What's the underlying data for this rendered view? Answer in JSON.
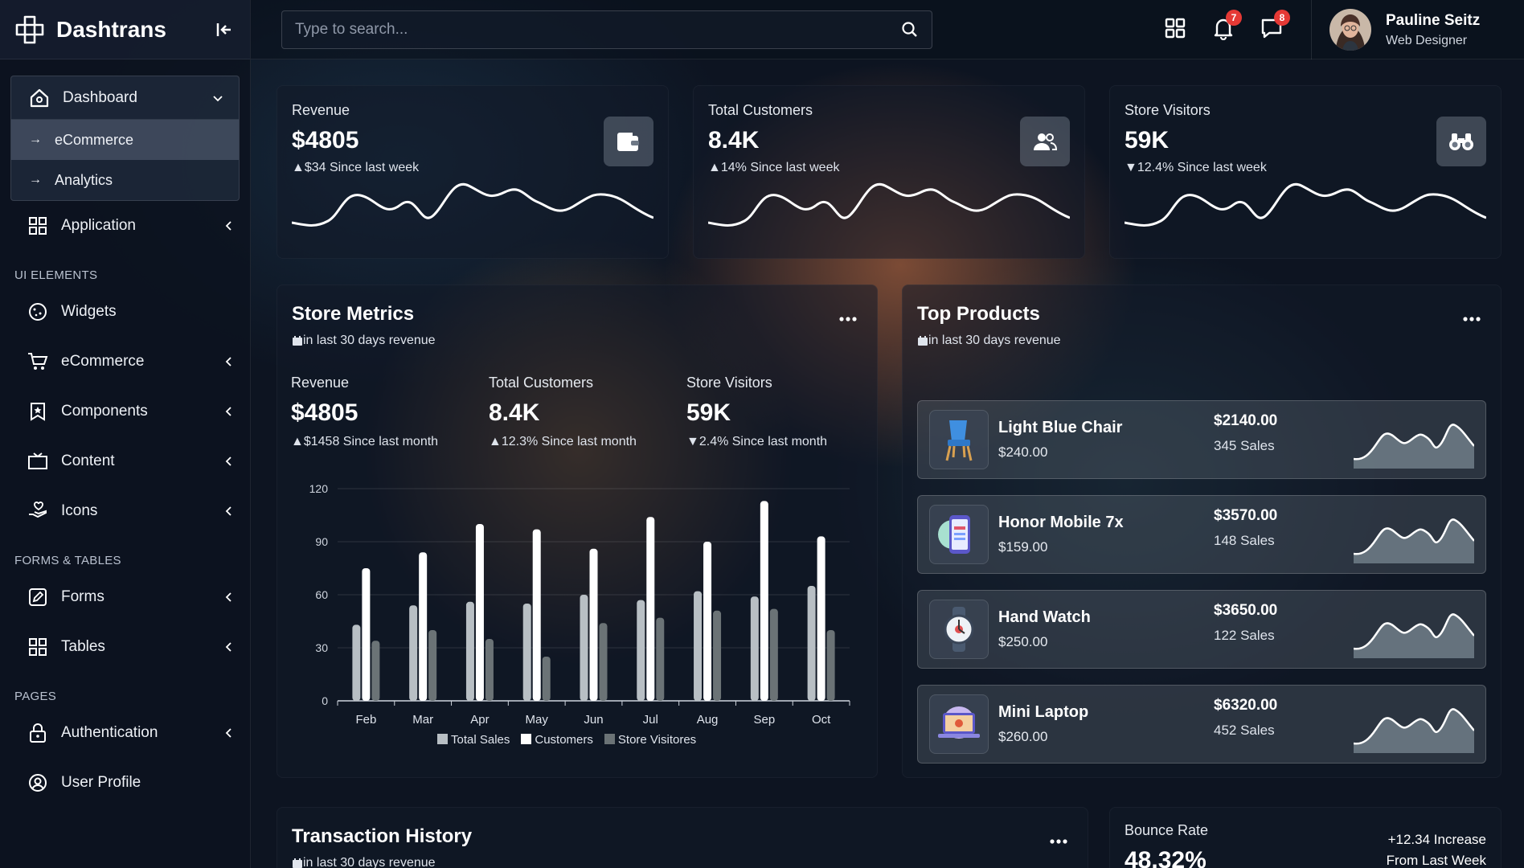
{
  "brand": {
    "name": "Dashtrans"
  },
  "search": {
    "placeholder": "Type to search..."
  },
  "topbar": {
    "notifications_count": "7",
    "messages_count": "8",
    "user_name": "Pauline Seitz",
    "user_role": "Web Designer"
  },
  "sidebar": {
    "dashboard": "Dashboard",
    "dashboard_sub": [
      "eCommerce",
      "Analytics"
    ],
    "application": "Application",
    "section_ui": "UI ELEMENTS",
    "widgets": "Widgets",
    "ecommerce": "eCommerce",
    "components": "Components",
    "content": "Content",
    "icons": "Icons",
    "section_forms": "FORMS & TABLES",
    "forms": "Forms",
    "tables": "Tables",
    "section_pages": "PAGES",
    "authentication": "Authentication",
    "user_profile": "User Profile"
  },
  "stats": [
    {
      "label": "Revenue",
      "value": "$4805",
      "trend": "$34 Since last week",
      "direction": "up",
      "icon": "wallet-icon"
    },
    {
      "label": "Total Customers",
      "value": "8.4K",
      "trend": "14% Since last week",
      "direction": "up",
      "icon": "users-icon"
    },
    {
      "label": "Store Visitors",
      "value": "59K",
      "trend": "12.4% Since last week",
      "direction": "down",
      "icon": "binoculars-icon"
    }
  ],
  "store_metrics": {
    "title": "Store Metrics",
    "subtitle": "in last 30 days revenue",
    "metrics": [
      {
        "label": "Revenue",
        "value": "$4805",
        "trend": "$1458 Since last month",
        "direction": "up"
      },
      {
        "label": "Total Customers",
        "value": "8.4K",
        "trend": "12.3% Since last month",
        "direction": "up"
      },
      {
        "label": "Store Visitors",
        "value": "59K",
        "trend": "2.4% Since last month",
        "direction": "down"
      }
    ]
  },
  "chart_data": {
    "type": "bar",
    "categories": [
      "Feb",
      "Mar",
      "Apr",
      "May",
      "Jun",
      "Jul",
      "Aug",
      "Sep",
      "Oct"
    ],
    "series": [
      {
        "name": "Total Sales",
        "values": [
          43,
          54,
          56,
          55,
          60,
          57,
          62,
          59,
          65
        ],
        "color": "#b8bfc4"
      },
      {
        "name": "Customers",
        "values": [
          75,
          84,
          100,
          97,
          86,
          104,
          90,
          113,
          93
        ],
        "color": "#ffffff"
      },
      {
        "name": "Store Visitores",
        "values": [
          34,
          40,
          35,
          25,
          44,
          47,
          51,
          52,
          40
        ],
        "color": "#6b7376"
      }
    ],
    "yticks": [
      "0",
      "30",
      "60",
      "90",
      "120"
    ],
    "ylim": [
      0,
      120
    ],
    "grid": true,
    "legend": "bottom"
  },
  "top_products": {
    "title": "Top Products",
    "subtitle": "in last 30 days revenue",
    "items": [
      {
        "name": "Light Blue Chair",
        "price": "$240.00",
        "total": "$2140.00",
        "sales": "345 Sales"
      },
      {
        "name": "Honor Mobile 7x",
        "price": "$159.00",
        "total": "$3570.00",
        "sales": "148 Sales"
      },
      {
        "name": "Hand Watch",
        "price": "$250.00",
        "total": "$3650.00",
        "sales": "122 Sales"
      },
      {
        "name": "Mini Laptop",
        "price": "$260.00",
        "total": "$6320.00",
        "sales": "452 Sales"
      }
    ]
  },
  "transactions": {
    "title": "Transaction History",
    "subtitle": "in last 30 days revenue"
  },
  "bounce": {
    "label": "Bounce Rate",
    "value": "48.32%",
    "increase": "+12.34 Increase",
    "period": "From Last Week"
  }
}
